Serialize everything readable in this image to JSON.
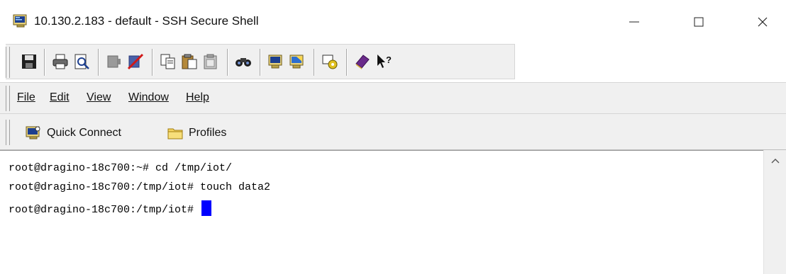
{
  "window": {
    "title": "10.130.2.183 - default - SSH Secure Shell",
    "icon": "ssh-terminal-icon",
    "controls": [
      "minimize-icon",
      "maximize-icon",
      "close-icon"
    ]
  },
  "toolbar": {
    "icons": [
      "save-icon",
      "print-icon",
      "print-preview-icon",
      "connect-icon",
      "disconnect-icon",
      "copy-icon",
      "paste-icon",
      "paste-clipboard-icon",
      "find-icon",
      "new-terminal-window-icon",
      "new-file-transfer-window-icon",
      "settings-icon",
      "help-book-icon",
      "context-help-icon"
    ]
  },
  "menu": {
    "items": [
      {
        "label": "File",
        "accel_index": 0
      },
      {
        "label": "Edit",
        "accel_index": 0
      },
      {
        "label": "View",
        "accel_index": 0
      },
      {
        "label": "Window",
        "accel_index": 0
      },
      {
        "label": "Help",
        "accel_index": 0
      }
    ]
  },
  "quickbar": {
    "quick_connect": "Quick Connect",
    "profiles": "Profiles"
  },
  "terminal": {
    "lines": [
      "root@dragino-18c700:~# cd /tmp/iot/",
      "root@dragino-18c700:/tmp/iot# touch data2",
      "root@dragino-18c700:/tmp/iot# "
    ],
    "cursor_color": "#0000ff"
  }
}
